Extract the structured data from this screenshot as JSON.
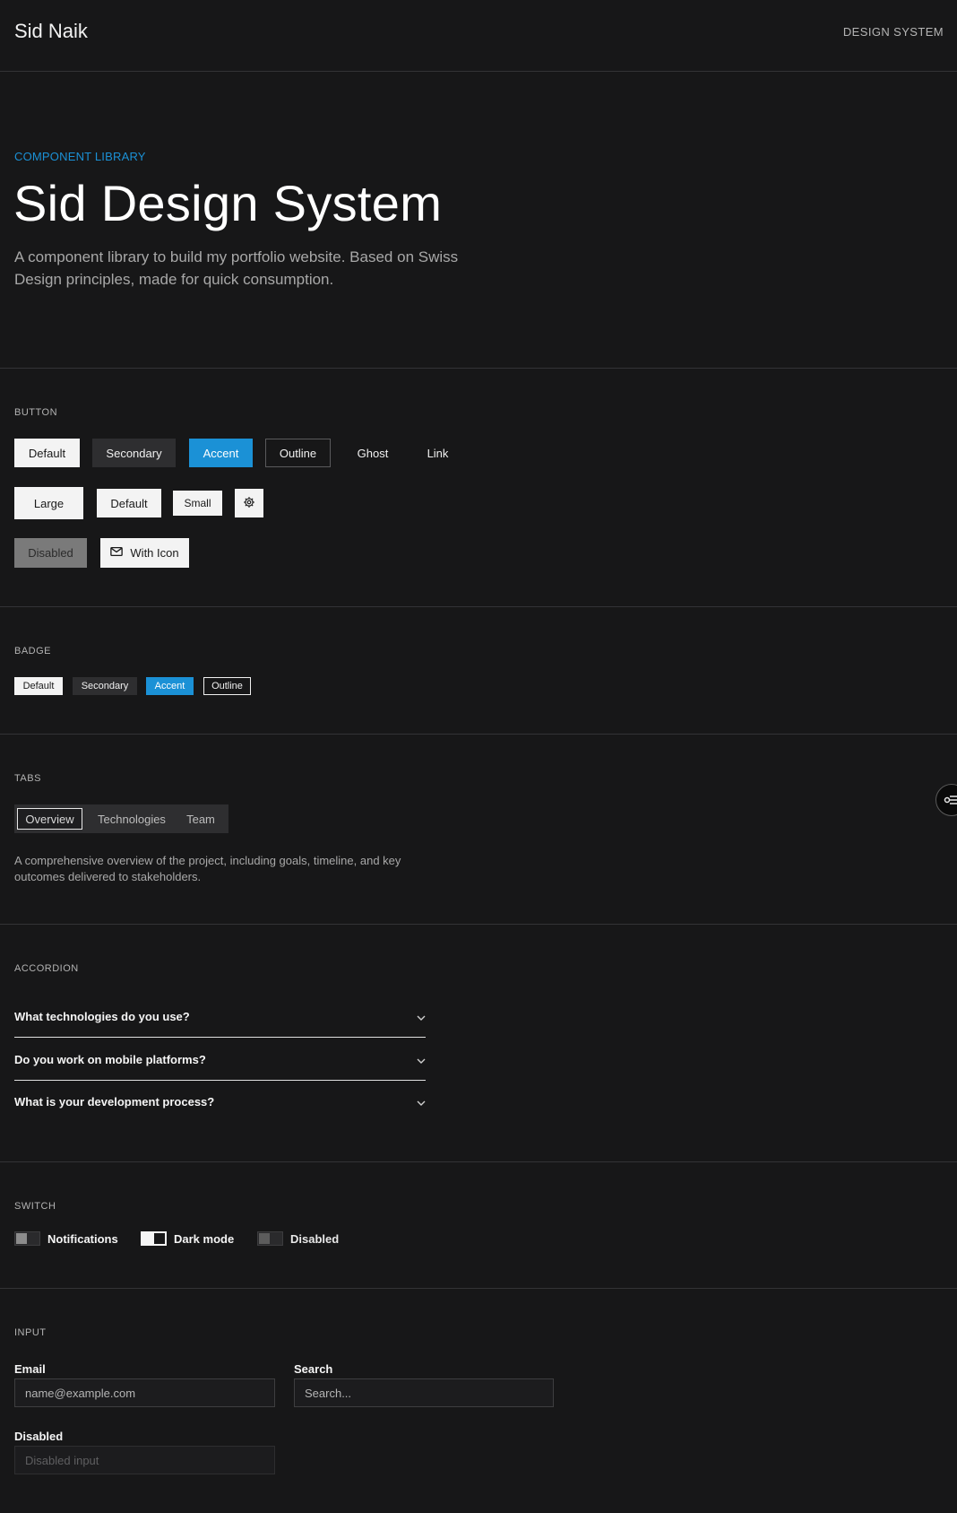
{
  "header": {
    "brand": "Sid Naik",
    "nav_link": "DESIGN SYSTEM"
  },
  "hero": {
    "eyebrow": "COMPONENT LIBRARY",
    "title": "Sid Design System",
    "description": "A component library to build my portfolio website. Based on Swiss Design principles, made for quick consumption."
  },
  "sections": {
    "button": "BUTTON",
    "badge": "BADGE",
    "tabs": "TABS",
    "accordion": "ACCORDION",
    "switch": "SWITCH",
    "input": "INPUT"
  },
  "buttons": {
    "variants": [
      "Default",
      "Secondary",
      "Accent",
      "Outline",
      "Ghost",
      "Link"
    ],
    "sizes": [
      "Large",
      "Default",
      "Small"
    ],
    "icon_button": "settings-icon",
    "disabled": "Disabled",
    "with_icon": "With Icon"
  },
  "badges": [
    "Default",
    "Secondary",
    "Accent",
    "Outline"
  ],
  "tabs": {
    "items": [
      "Overview",
      "Technologies",
      "Team"
    ],
    "active": "Overview",
    "content": "A comprehensive overview of the project, including goals, timeline, and key outcomes delivered to stakeholders."
  },
  "accordion": [
    "What technologies do you use?",
    "Do you work on mobile platforms?",
    "What is your development process?"
  ],
  "switches": [
    {
      "label": "Notifications",
      "state": "off"
    },
    {
      "label": "Dark mode",
      "state": "on"
    },
    {
      "label": "Disabled",
      "state": "disabled"
    }
  ],
  "inputs": {
    "email": {
      "label": "Email",
      "placeholder": "name@example.com",
      "value": ""
    },
    "search": {
      "label": "Search",
      "placeholder": "Search...",
      "value": ""
    },
    "disabled": {
      "label": "Disabled",
      "placeholder": "Disabled input",
      "value": ""
    }
  },
  "colors": {
    "background": "#171718",
    "accent": "#1b91d6",
    "secondary": "#2e2e30"
  }
}
